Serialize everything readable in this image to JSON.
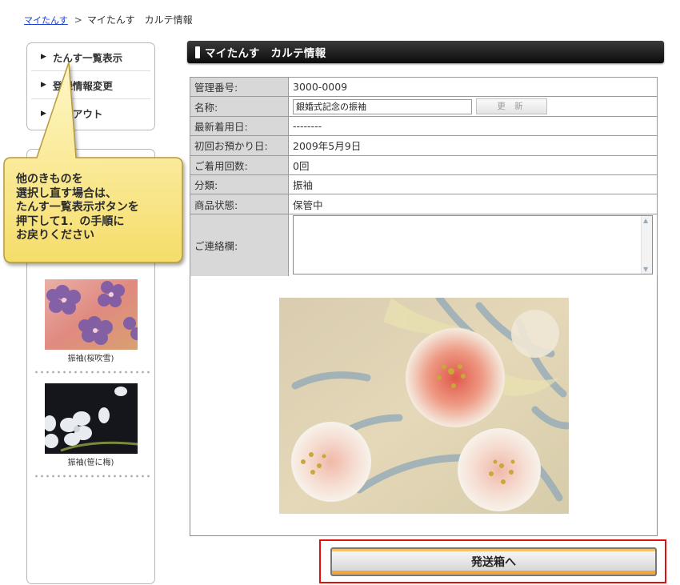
{
  "breadcrumb": {
    "home": "マイたんす",
    "separator": ">",
    "current": "マイたんす　カルテ情報"
  },
  "sidebar": {
    "menu": [
      {
        "label": "たんす一覧表示"
      },
      {
        "label": "登録情報変更"
      },
      {
        "label": "ログアウト"
      }
    ],
    "items": [
      {
        "caption": "振袖(桜吹雪)"
      },
      {
        "caption": "振袖(笹に梅)"
      }
    ]
  },
  "callout": {
    "text": "他のきものを\n選択し直す場合は、\nたんす一覧表示ボタンを\n押下して1．の手順に\nお戻りください"
  },
  "main": {
    "title": "マイたんす　カルテ情報",
    "rows": {
      "mgmt_no": {
        "label": "管理番号:",
        "value": "3000-0009"
      },
      "name": {
        "label": "名称:",
        "value": "銀婚式記念の振袖",
        "button": "更 新"
      },
      "last_worn": {
        "label": "最新着用日:",
        "value": "--------"
      },
      "first_deposit": {
        "label": "初回お預かり日:",
        "value": "2009年5月9日"
      },
      "wear_count": {
        "label": "ご着用回数:",
        "value": "0回"
      },
      "category": {
        "label": "分類:",
        "value": "振袖"
      },
      "status": {
        "label": "商品状態:",
        "value": "保管中"
      },
      "contact": {
        "label": "ご連絡欄:",
        "value": ""
      }
    }
  },
  "send_button": {
    "label": "発送箱へ"
  },
  "colors": {
    "header_bg": "#111111",
    "highlight_frame": "#e01010",
    "button_accent": "#f2a640"
  }
}
